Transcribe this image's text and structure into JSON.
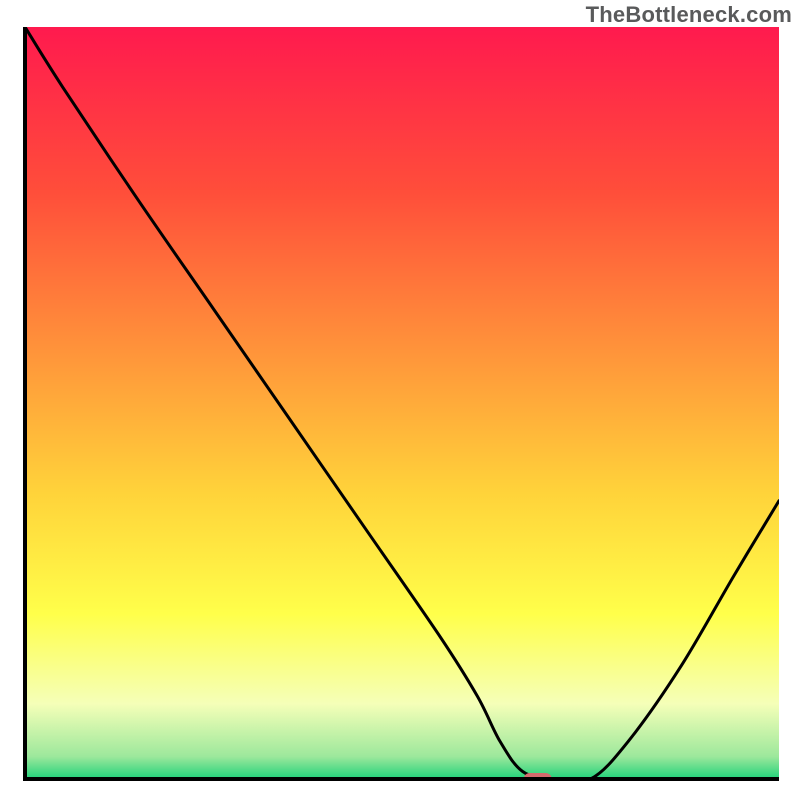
{
  "attribution": "TheBottleneck.com",
  "colors": {
    "axis": "#000000",
    "curve": "#000000",
    "marker_fill": "#d46a6d",
    "marker_outline": "#b5585b",
    "gradient_stops": [
      {
        "offset": 0.0,
        "color": "#ff1a4e"
      },
      {
        "offset": 0.22,
        "color": "#ff4e3a"
      },
      {
        "offset": 0.42,
        "color": "#ff903a"
      },
      {
        "offset": 0.62,
        "color": "#ffd33a"
      },
      {
        "offset": 0.78,
        "color": "#ffff4a"
      },
      {
        "offset": 0.9,
        "color": "#f5ffb8"
      },
      {
        "offset": 0.97,
        "color": "#9de89c"
      },
      {
        "offset": 1.0,
        "color": "#20d27a"
      }
    ]
  },
  "chart_data": {
    "type": "line",
    "title": "",
    "xlabel": "",
    "ylabel": "",
    "xlim": [
      0,
      100
    ],
    "ylim": [
      0,
      100
    ],
    "x": [
      0,
      5,
      15,
      25,
      35,
      45,
      55,
      60,
      63,
      66,
      70,
      75,
      80,
      87,
      94,
      100
    ],
    "values": [
      100,
      92,
      77,
      62.5,
      48,
      33.5,
      19,
      11,
      5,
      1,
      0,
      0,
      5,
      15,
      27,
      37
    ],
    "optimum_region": {
      "x_start": 63,
      "x_end": 73,
      "y": 0
    },
    "marker": {
      "x": 68,
      "y": 0
    }
  }
}
